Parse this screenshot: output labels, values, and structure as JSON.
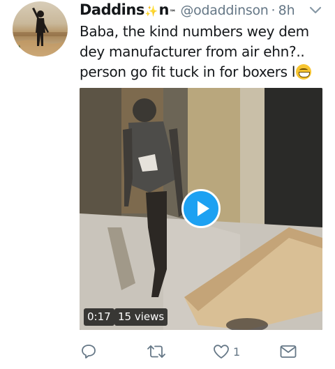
{
  "tweet": {
    "author_name": "Daddins",
    "author_name_suffix": "n",
    "author_trademark": "™",
    "handle": "@odaddinson",
    "separator": "·",
    "time": "8h",
    "text_line1": "Baba, the kind numbers wey dem",
    "text_line2": "dey manufacturer from air ehn?..",
    "text_line3": "person go fit tuck in for boxers l"
  },
  "video": {
    "duration": "0:17",
    "views": "15 views"
  },
  "actions": {
    "reply_icon": "reply-icon",
    "retweet_icon": "retweet-icon",
    "like_icon": "heart-icon",
    "like_count": "1",
    "dm_icon": "envelope-icon"
  },
  "colors": {
    "text": "#14171a",
    "muted": "#657786",
    "accent": "#1da1f2"
  }
}
